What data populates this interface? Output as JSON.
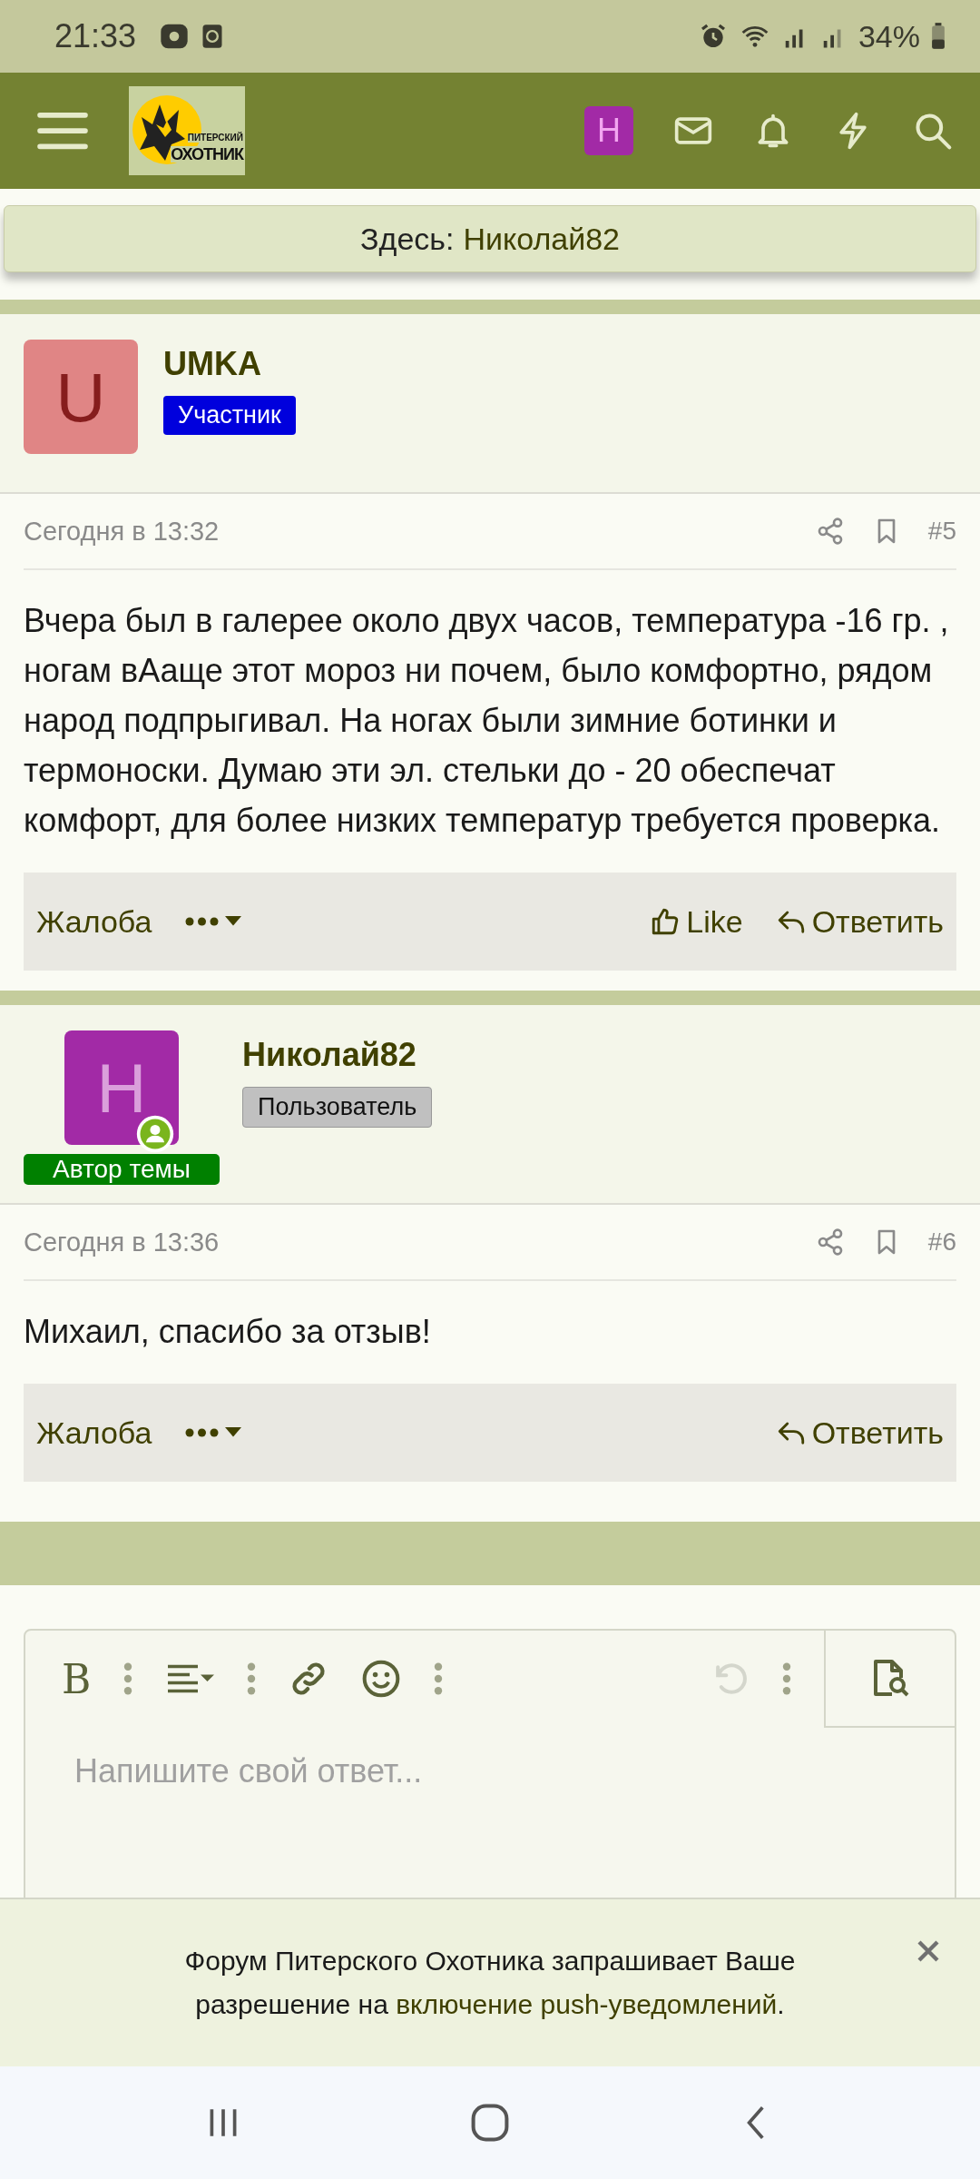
{
  "status_bar": {
    "time": "21:33",
    "battery": "34%"
  },
  "header": {
    "logo_lines": [
      "ПИТЕРСКИЙ",
      "ОХОТНИК"
    ],
    "avatar_letter": "H"
  },
  "location": {
    "label": "Здесь:",
    "value": "Николай82"
  },
  "posts": [
    {
      "author": "UMKA",
      "avatar_letter": "U",
      "color": "#e08585",
      "role": {
        "kind": "member",
        "label": "Участник"
      },
      "online": false,
      "date": "Сегодня в 13:32",
      "number": "#5",
      "text": "Вчера был в галерее около двух часов, температура -16 гр. , ногам вАаще этот мороз ни почем, было комфортно, рядом народ подпрыгивал. На ногах были зимние ботинки и термоноски. Думаю эти эл. стельки до - 20 обеспечат комфорт, для более низких температур требуется проверка.",
      "report": "Жалоба",
      "actions": [
        {
          "kind": "like",
          "label": "Like"
        },
        {
          "kind": "reply",
          "label": "Ответить"
        }
      ]
    },
    {
      "author": "Николай82",
      "avatar_letter": "H",
      "color": "#a22aa6",
      "role": {
        "kind": "user",
        "label": "Пользователь"
      },
      "online": true,
      "starter_badge": "Автор темы",
      "date": "Сегодня в 13:36",
      "number": "#6",
      "text": "Михаил, спасибо за отзыв!",
      "report": "Жалоба",
      "actions": [
        {
          "kind": "reply",
          "label": "Ответить"
        }
      ]
    }
  ],
  "editor": {
    "bold_label": "B",
    "undo_disabled": true,
    "placeholder": "Напишите свой ответ..."
  },
  "notice": {
    "text": "Форум Питерского Охотника запрашивает Ваше разрешение на ",
    "link": "включение push-уведомлений",
    "end": "."
  }
}
